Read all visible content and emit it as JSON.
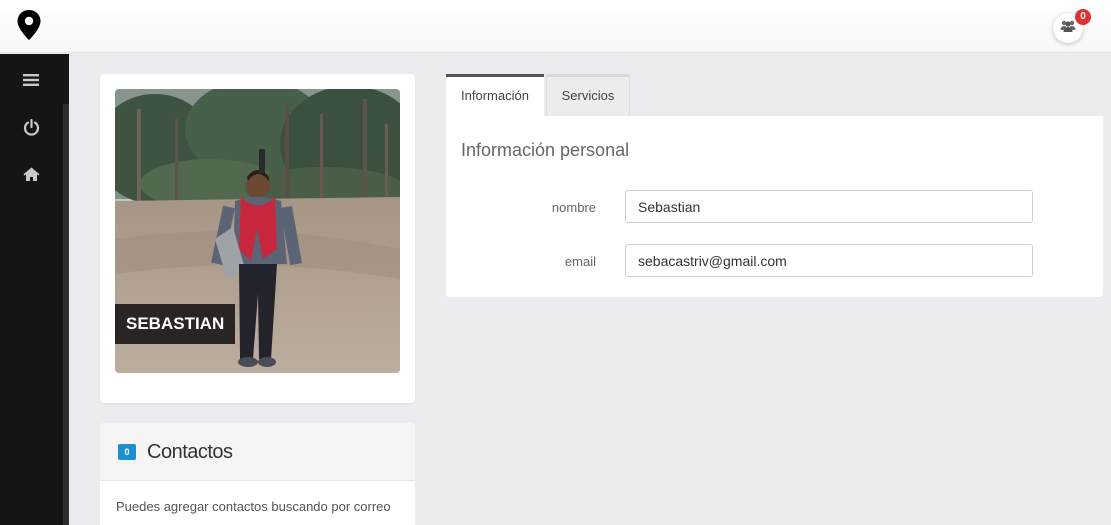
{
  "topbar": {
    "logo_icon": "map-marker-icon",
    "group_icon": "users-icon",
    "notification_count": "0",
    "badge_color": "#e0312d"
  },
  "sidebar": {
    "items": [
      {
        "icon": "menu-icon"
      },
      {
        "icon": "power-icon"
      },
      {
        "icon": "home-icon"
      }
    ]
  },
  "profile": {
    "name": "SEBASTIAN"
  },
  "contacts": {
    "count": "0",
    "title": "Contactos",
    "description": "Puedes agregar contactos buscando por correo",
    "badge_color": "#1a8fd1"
  },
  "tabs": [
    {
      "label": "Información",
      "active": true
    },
    {
      "label": "Servicios",
      "active": false
    }
  ],
  "info": {
    "title": "Información personal",
    "fields": [
      {
        "label": "nombre",
        "value": "Sebastian"
      },
      {
        "label": "email",
        "value": "sebacastriv@gmail.com"
      }
    ]
  }
}
